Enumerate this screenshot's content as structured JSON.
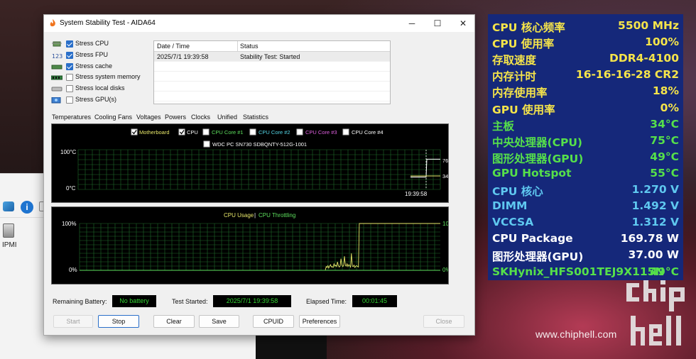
{
  "window": {
    "title": "System Stability Test - AIDA64",
    "controls": {
      "minimize": "─",
      "maximize": "☐",
      "close": "✕"
    }
  },
  "stress_options": [
    {
      "label": "Stress CPU",
      "checked": true,
      "icon": "cpu-chip-icon"
    },
    {
      "label": "Stress FPU",
      "checked": true,
      "icon": "fpu-123-icon"
    },
    {
      "label": "Stress cache",
      "checked": true,
      "icon": "cache-chip-icon"
    },
    {
      "label": "Stress system memory",
      "checked": false,
      "icon": "memory-module-icon"
    },
    {
      "label": "Stress local disks",
      "checked": false,
      "icon": "disk-drive-icon"
    },
    {
      "label": "Stress GPU(s)",
      "checked": false,
      "icon": "gpu-card-icon"
    }
  ],
  "log": {
    "columns": [
      "Date / Time",
      "Status"
    ],
    "rows": [
      {
        "time": "2025/7/1 19:39:58",
        "status": "Stability Test: Started"
      }
    ]
  },
  "tabs": [
    "Temperatures",
    "Cooling Fans",
    "Voltages",
    "Powers",
    "Clocks",
    "Unified",
    "Statistics"
  ],
  "temperature_graph": {
    "legend": [
      {
        "label": "Motherboard",
        "checked": true,
        "color": "#e8e86a"
      },
      {
        "label": "CPU",
        "checked": true,
        "color": "#ffffff"
      },
      {
        "label": "CPU Core #1",
        "checked": false,
        "color": "#5ee05e"
      },
      {
        "label": "CPU Core #2",
        "checked": false,
        "color": "#55d8e8"
      },
      {
        "label": "CPU Core #3",
        "checked": false,
        "color": "#e060e0"
      },
      {
        "label": "CPU Core #4",
        "checked": false,
        "color": "#ffffff"
      },
      {
        "label": "WDC PC SN730 SDBQNTY-512G-1001",
        "checked": false,
        "color": "#ffffff"
      }
    ],
    "y_top_label": "100°C",
    "y_bottom_label": "0°C",
    "time_label": "19:39:58",
    "value_cpu": "76",
    "value_mb": "34"
  },
  "usage_graph": {
    "title_usage": "CPU Usage",
    "title_sep": "|",
    "title_throttle": "CPU Throttling",
    "y_top_left": "100%",
    "y_bottom_left": "0%",
    "y_top_right": "100%",
    "y_bottom_right": "0%"
  },
  "chart_data": [
    {
      "type": "line",
      "title": "",
      "series": [
        {
          "name": "CPU",
          "values": [
            31,
            31,
            31,
            76,
            76
          ]
        },
        {
          "name": "Motherboard",
          "values": [
            34,
            34,
            34,
            34,
            34
          ]
        }
      ],
      "ylim": [
        0,
        100
      ],
      "xlabel": "",
      "ylabel": "",
      "x_tick_labels": [
        "19:39:58"
      ]
    },
    {
      "type": "line",
      "title": "CPU Usage | CPU Throttling",
      "series": [
        {
          "name": "CPU Usage",
          "values": [
            0,
            0,
            0,
            0,
            0,
            0,
            0,
            0,
            0,
            0,
            0,
            0,
            0,
            0,
            0,
            0,
            0,
            0,
            0,
            0,
            0,
            0,
            0,
            0,
            0,
            0,
            0,
            0,
            0,
            0,
            0,
            0,
            0,
            0,
            0,
            0,
            0,
            0,
            0,
            0,
            0,
            0,
            0,
            0,
            0,
            0,
            0,
            0,
            0,
            0,
            0,
            0,
            0,
            0,
            0,
            0,
            0,
            0,
            0,
            0,
            0,
            0,
            0,
            0,
            0,
            0,
            0,
            0,
            0,
            0,
            0,
            0,
            0,
            0,
            0,
            0,
            0,
            0,
            0,
            0,
            0,
            0,
            0,
            0,
            0,
            0,
            0,
            0,
            0,
            0,
            0,
            0,
            0,
            0,
            0,
            0,
            0,
            0,
            0,
            0,
            0,
            0,
            0,
            0,
            0,
            0,
            0,
            0,
            0,
            0,
            0,
            0,
            0,
            0,
            0,
            0,
            0,
            0,
            0,
            0,
            0,
            0,
            0,
            0,
            0,
            0,
            0,
            0,
            0,
            0,
            0,
            0,
            0,
            0,
            0,
            0,
            0,
            0,
            0,
            0,
            0,
            0,
            0,
            0,
            0,
            0,
            0,
            0,
            0,
            0,
            0,
            0,
            0,
            0,
            0,
            0,
            0,
            0,
            0,
            0,
            0,
            0,
            0,
            0,
            0,
            0,
            0,
            0,
            0,
            0,
            0,
            0,
            0,
            0,
            0,
            0,
            0,
            0,
            0,
            0,
            0,
            0,
            0,
            0,
            0,
            0,
            0,
            0,
            0,
            0,
            0,
            0,
            0,
            0,
            0,
            0,
            0,
            0,
            0,
            0,
            0,
            0,
            0,
            0,
            0,
            0,
            0,
            0,
            0,
            0,
            0,
            0,
            0,
            0,
            0,
            0,
            0,
            0,
            0,
            0,
            0,
            0,
            0,
            0,
            0,
            0,
            0,
            0,
            0,
            0,
            0,
            0,
            0,
            0,
            0,
            0,
            0,
            0,
            0,
            0,
            0,
            0,
            0,
            0,
            0,
            0,
            0,
            0,
            0,
            0,
            0,
            0,
            0,
            0,
            0,
            0,
            0,
            0,
            0,
            0,
            0,
            0,
            0,
            0,
            0,
            0,
            0,
            0,
            0,
            0,
            0,
            0,
            0,
            0,
            0,
            0,
            0,
            0,
            0,
            0,
            0,
            0,
            0,
            8,
            6,
            10,
            5,
            9,
            12,
            7,
            8,
            6,
            14,
            9,
            11,
            8,
            18,
            10,
            7,
            9,
            25,
            12,
            8,
            10,
            30,
            11,
            9,
            14,
            8,
            12,
            10,
            7,
            36,
            9,
            8,
            11,
            6,
            9,
            10,
            8,
            7,
            100,
            100,
            100,
            100,
            100,
            100,
            100,
            100,
            100,
            100,
            100,
            100,
            100,
            100,
            100,
            100,
            100,
            100,
            100,
            100,
            100,
            100,
            100,
            100,
            100,
            100,
            100,
            100,
            100,
            100,
            100,
            100,
            100,
            100,
            100,
            100,
            100,
            100,
            100,
            100,
            100,
            100,
            100,
            100,
            100,
            100,
            100,
            100,
            100,
            100,
            100,
            100,
            100,
            100,
            100,
            100,
            100,
            100,
            100,
            100,
            100,
            100,
            100,
            100,
            100,
            100,
            100,
            100,
            100,
            100,
            100,
            100,
            100,
            100,
            100,
            100,
            100,
            100,
            100,
            100,
            100,
            100,
            100,
            100,
            100,
            100,
            100,
            100,
            100,
            100,
            100,
            100,
            100,
            100
          ]
        },
        {
          "name": "CPU Throttling",
          "values": [
            0
          ]
        }
      ],
      "ylim": [
        0,
        100
      ],
      "xlabel": "",
      "ylabel": ""
    }
  ],
  "status": {
    "battery_label": "Remaining Battery:",
    "battery_value": "No battery",
    "started_label": "Test Started:",
    "started_value": "2025/7/1 19:39:58",
    "elapsed_label": "Elapsed Time:",
    "elapsed_value": "00:01:45"
  },
  "buttons": {
    "start": "Start",
    "stop": "Stop",
    "clear": "Clear",
    "save": "Save",
    "cpuid": "CPUID",
    "preferences": "Preferences",
    "close": "Close"
  },
  "osd": {
    "rows": [
      {
        "label": "CPU 核心频率",
        "value": "5500 MHz",
        "color": "#f5e44a"
      },
      {
        "label": "CPU 使用率",
        "value": "100%",
        "color": "#f5e44a"
      },
      {
        "label": "存取速度",
        "value": "DDR4-4100",
        "color": "#f5e44a"
      },
      {
        "label": "内存计时",
        "value": "16-16-16-28 CR2",
        "color": "#f5e44a"
      },
      {
        "label": "内存使用率",
        "value": "18%",
        "color": "#f5e44a"
      },
      {
        "label": "GPU 使用率",
        "value": "0%",
        "color": "#f5e44a"
      },
      {
        "label": "主板",
        "value": "34°C",
        "color": "#56e04a"
      },
      {
        "label": "中央处理器(CPU)",
        "value": "75°C",
        "color": "#56e04a"
      },
      {
        "label": "图形处理器(GPU)",
        "value": "49°C",
        "color": "#56e04a"
      },
      {
        "label": "GPU Hotspot",
        "value": "55°C",
        "color": "#56e04a"
      },
      {
        "label": "CPU 核心",
        "value": "1.270 V",
        "color": "#5fc8f0"
      },
      {
        "label": "DIMM",
        "value": "1.492 V",
        "color": "#5fc8f0"
      },
      {
        "label": "VCCSA",
        "value": "1.312 V",
        "color": "#5fc8f0"
      },
      {
        "label": "CPU Package",
        "value": "169.78 W",
        "color": "#ffffff"
      },
      {
        "label": "图形处理器(GPU)",
        "value": "37.00 W",
        "color": "#ffffff"
      },
      {
        "label": "SKHynix_HFS001TEJ9X115N",
        "value": "49°C",
        "color": "#56e04a"
      }
    ]
  },
  "background": {
    "desktop_label": "IPMI"
  },
  "watermark": {
    "url": "www.chiphell.com",
    "logo": "chip hell"
  }
}
